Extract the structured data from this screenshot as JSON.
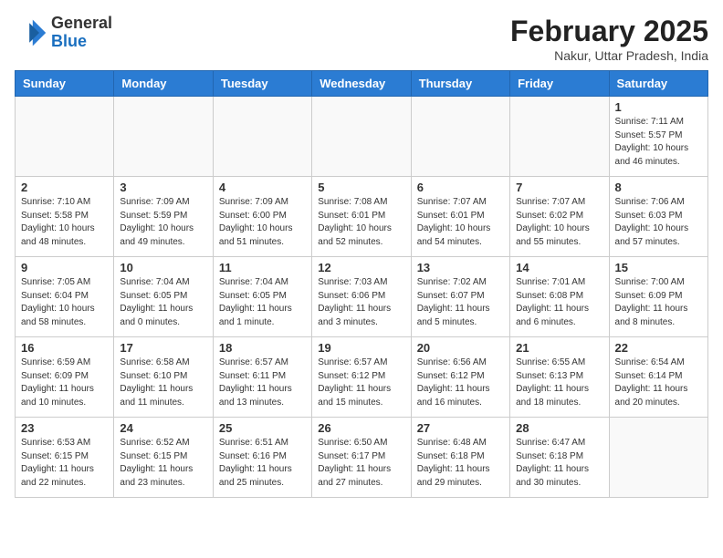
{
  "header": {
    "logo_general": "General",
    "logo_blue": "Blue",
    "month_year": "February 2025",
    "location": "Nakur, Uttar Pradesh, India"
  },
  "days_of_week": [
    "Sunday",
    "Monday",
    "Tuesday",
    "Wednesday",
    "Thursday",
    "Friday",
    "Saturday"
  ],
  "weeks": [
    [
      {
        "day": "",
        "info": ""
      },
      {
        "day": "",
        "info": ""
      },
      {
        "day": "",
        "info": ""
      },
      {
        "day": "",
        "info": ""
      },
      {
        "day": "",
        "info": ""
      },
      {
        "day": "",
        "info": ""
      },
      {
        "day": "1",
        "info": "Sunrise: 7:11 AM\nSunset: 5:57 PM\nDaylight: 10 hours\nand 46 minutes."
      }
    ],
    [
      {
        "day": "2",
        "info": "Sunrise: 7:10 AM\nSunset: 5:58 PM\nDaylight: 10 hours\nand 48 minutes."
      },
      {
        "day": "3",
        "info": "Sunrise: 7:09 AM\nSunset: 5:59 PM\nDaylight: 10 hours\nand 49 minutes."
      },
      {
        "day": "4",
        "info": "Sunrise: 7:09 AM\nSunset: 6:00 PM\nDaylight: 10 hours\nand 51 minutes."
      },
      {
        "day": "5",
        "info": "Sunrise: 7:08 AM\nSunset: 6:01 PM\nDaylight: 10 hours\nand 52 minutes."
      },
      {
        "day": "6",
        "info": "Sunrise: 7:07 AM\nSunset: 6:01 PM\nDaylight: 10 hours\nand 54 minutes."
      },
      {
        "day": "7",
        "info": "Sunrise: 7:07 AM\nSunset: 6:02 PM\nDaylight: 10 hours\nand 55 minutes."
      },
      {
        "day": "8",
        "info": "Sunrise: 7:06 AM\nSunset: 6:03 PM\nDaylight: 10 hours\nand 57 minutes."
      }
    ],
    [
      {
        "day": "9",
        "info": "Sunrise: 7:05 AM\nSunset: 6:04 PM\nDaylight: 10 hours\nand 58 minutes."
      },
      {
        "day": "10",
        "info": "Sunrise: 7:04 AM\nSunset: 6:05 PM\nDaylight: 11 hours\nand 0 minutes."
      },
      {
        "day": "11",
        "info": "Sunrise: 7:04 AM\nSunset: 6:05 PM\nDaylight: 11 hours\nand 1 minute."
      },
      {
        "day": "12",
        "info": "Sunrise: 7:03 AM\nSunset: 6:06 PM\nDaylight: 11 hours\nand 3 minutes."
      },
      {
        "day": "13",
        "info": "Sunrise: 7:02 AM\nSunset: 6:07 PM\nDaylight: 11 hours\nand 5 minutes."
      },
      {
        "day": "14",
        "info": "Sunrise: 7:01 AM\nSunset: 6:08 PM\nDaylight: 11 hours\nand 6 minutes."
      },
      {
        "day": "15",
        "info": "Sunrise: 7:00 AM\nSunset: 6:09 PM\nDaylight: 11 hours\nand 8 minutes."
      }
    ],
    [
      {
        "day": "16",
        "info": "Sunrise: 6:59 AM\nSunset: 6:09 PM\nDaylight: 11 hours\nand 10 minutes."
      },
      {
        "day": "17",
        "info": "Sunrise: 6:58 AM\nSunset: 6:10 PM\nDaylight: 11 hours\nand 11 minutes."
      },
      {
        "day": "18",
        "info": "Sunrise: 6:57 AM\nSunset: 6:11 PM\nDaylight: 11 hours\nand 13 minutes."
      },
      {
        "day": "19",
        "info": "Sunrise: 6:57 AM\nSunset: 6:12 PM\nDaylight: 11 hours\nand 15 minutes."
      },
      {
        "day": "20",
        "info": "Sunrise: 6:56 AM\nSunset: 6:12 PM\nDaylight: 11 hours\nand 16 minutes."
      },
      {
        "day": "21",
        "info": "Sunrise: 6:55 AM\nSunset: 6:13 PM\nDaylight: 11 hours\nand 18 minutes."
      },
      {
        "day": "22",
        "info": "Sunrise: 6:54 AM\nSunset: 6:14 PM\nDaylight: 11 hours\nand 20 minutes."
      }
    ],
    [
      {
        "day": "23",
        "info": "Sunrise: 6:53 AM\nSunset: 6:15 PM\nDaylight: 11 hours\nand 22 minutes."
      },
      {
        "day": "24",
        "info": "Sunrise: 6:52 AM\nSunset: 6:15 PM\nDaylight: 11 hours\nand 23 minutes."
      },
      {
        "day": "25",
        "info": "Sunrise: 6:51 AM\nSunset: 6:16 PM\nDaylight: 11 hours\nand 25 minutes."
      },
      {
        "day": "26",
        "info": "Sunrise: 6:50 AM\nSunset: 6:17 PM\nDaylight: 11 hours\nand 27 minutes."
      },
      {
        "day": "27",
        "info": "Sunrise: 6:48 AM\nSunset: 6:18 PM\nDaylight: 11 hours\nand 29 minutes."
      },
      {
        "day": "28",
        "info": "Sunrise: 6:47 AM\nSunset: 6:18 PM\nDaylight: 11 hours\nand 30 minutes."
      },
      {
        "day": "",
        "info": ""
      }
    ]
  ]
}
